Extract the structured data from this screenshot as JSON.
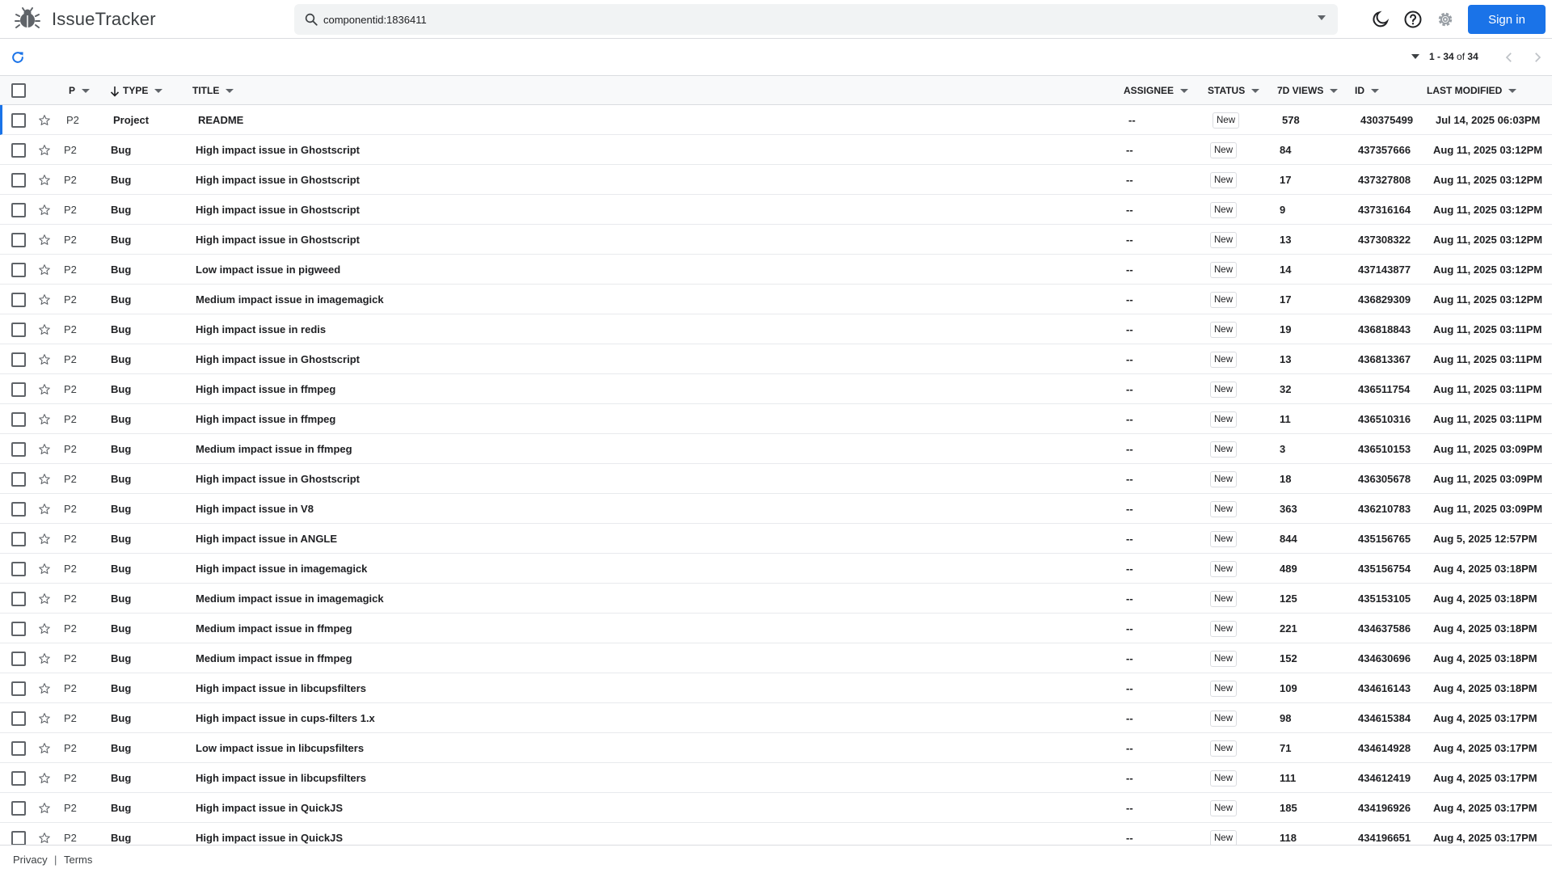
{
  "app": {
    "title": "IssueTracker"
  },
  "search": {
    "query": "componentid:1836411"
  },
  "header": {
    "sign_in_label": "Sign in"
  },
  "pagination": {
    "range": "1 - 34",
    "of_label": "of",
    "total": "34"
  },
  "columns": {
    "priority": "P",
    "type": "TYPE",
    "title": "TITLE",
    "assignee": "ASSIGNEE",
    "status": "STATUS",
    "views": "7D VIEWS",
    "id": "ID",
    "last_modified": "LAST MODIFIED"
  },
  "rows": [
    {
      "priority": "P2",
      "type": "Project",
      "title": "README",
      "assignee": "--",
      "status": "New",
      "views": "578",
      "id": "430375499",
      "last_modified": "Jul 14, 2025 06:03PM"
    },
    {
      "priority": "P2",
      "type": "Bug",
      "title": "High impact issue in Ghostscript",
      "assignee": "--",
      "status": "New",
      "views": "84",
      "id": "437357666",
      "last_modified": "Aug 11, 2025 03:12PM"
    },
    {
      "priority": "P2",
      "type": "Bug",
      "title": "High impact issue in Ghostscript",
      "assignee": "--",
      "status": "New",
      "views": "17",
      "id": "437327808",
      "last_modified": "Aug 11, 2025 03:12PM"
    },
    {
      "priority": "P2",
      "type": "Bug",
      "title": "High impact issue in Ghostscript",
      "assignee": "--",
      "status": "New",
      "views": "9",
      "id": "437316164",
      "last_modified": "Aug 11, 2025 03:12PM"
    },
    {
      "priority": "P2",
      "type": "Bug",
      "title": "High impact issue in Ghostscript",
      "assignee": "--",
      "status": "New",
      "views": "13",
      "id": "437308322",
      "last_modified": "Aug 11, 2025 03:12PM"
    },
    {
      "priority": "P2",
      "type": "Bug",
      "title": "Low impact issue in pigweed",
      "assignee": "--",
      "status": "New",
      "views": "14",
      "id": "437143877",
      "last_modified": "Aug 11, 2025 03:12PM"
    },
    {
      "priority": "P2",
      "type": "Bug",
      "title": "Medium impact issue in imagemagick",
      "assignee": "--",
      "status": "New",
      "views": "17",
      "id": "436829309",
      "last_modified": "Aug 11, 2025 03:12PM"
    },
    {
      "priority": "P2",
      "type": "Bug",
      "title": "High impact issue in redis",
      "assignee": "--",
      "status": "New",
      "views": "19",
      "id": "436818843",
      "last_modified": "Aug 11, 2025 03:11PM"
    },
    {
      "priority": "P2",
      "type": "Bug",
      "title": "High impact issue in Ghostscript",
      "assignee": "--",
      "status": "New",
      "views": "13",
      "id": "436813367",
      "last_modified": "Aug 11, 2025 03:11PM"
    },
    {
      "priority": "P2",
      "type": "Bug",
      "title": "High impact issue in ffmpeg",
      "assignee": "--",
      "status": "New",
      "views": "32",
      "id": "436511754",
      "last_modified": "Aug 11, 2025 03:11PM"
    },
    {
      "priority": "P2",
      "type": "Bug",
      "title": "High impact issue in ffmpeg",
      "assignee": "--",
      "status": "New",
      "views": "11",
      "id": "436510316",
      "last_modified": "Aug 11, 2025 03:11PM"
    },
    {
      "priority": "P2",
      "type": "Bug",
      "title": "Medium impact issue in ffmpeg",
      "assignee": "--",
      "status": "New",
      "views": "3",
      "id": "436510153",
      "last_modified": "Aug 11, 2025 03:09PM"
    },
    {
      "priority": "P2",
      "type": "Bug",
      "title": "High impact issue in Ghostscript",
      "assignee": "--",
      "status": "New",
      "views": "18",
      "id": "436305678",
      "last_modified": "Aug 11, 2025 03:09PM"
    },
    {
      "priority": "P2",
      "type": "Bug",
      "title": "High impact issue in V8",
      "assignee": "--",
      "status": "New",
      "views": "363",
      "id": "436210783",
      "last_modified": "Aug 11, 2025 03:09PM"
    },
    {
      "priority": "P2",
      "type": "Bug",
      "title": "High impact issue in ANGLE",
      "assignee": "--",
      "status": "New",
      "views": "844",
      "id": "435156765",
      "last_modified": "Aug 5, 2025 12:57PM"
    },
    {
      "priority": "P2",
      "type": "Bug",
      "title": "High impact issue in imagemagick",
      "assignee": "--",
      "status": "New",
      "views": "489",
      "id": "435156754",
      "last_modified": "Aug 4, 2025 03:18PM"
    },
    {
      "priority": "P2",
      "type": "Bug",
      "title": "Medium impact issue in imagemagick",
      "assignee": "--",
      "status": "New",
      "views": "125",
      "id": "435153105",
      "last_modified": "Aug 4, 2025 03:18PM"
    },
    {
      "priority": "P2",
      "type": "Bug",
      "title": "Medium impact issue in ffmpeg",
      "assignee": "--",
      "status": "New",
      "views": "221",
      "id": "434637586",
      "last_modified": "Aug 4, 2025 03:18PM"
    },
    {
      "priority": "P2",
      "type": "Bug",
      "title": "Medium impact issue in ffmpeg",
      "assignee": "--",
      "status": "New",
      "views": "152",
      "id": "434630696",
      "last_modified": "Aug 4, 2025 03:18PM"
    },
    {
      "priority": "P2",
      "type": "Bug",
      "title": "High impact issue in libcupsfilters",
      "assignee": "--",
      "status": "New",
      "views": "109",
      "id": "434616143",
      "last_modified": "Aug 4, 2025 03:18PM"
    },
    {
      "priority": "P2",
      "type": "Bug",
      "title": "High impact issue in cups-filters 1.x",
      "assignee": "--",
      "status": "New",
      "views": "98",
      "id": "434615384",
      "last_modified": "Aug 4, 2025 03:17PM"
    },
    {
      "priority": "P2",
      "type": "Bug",
      "title": "Low impact issue in libcupsfilters",
      "assignee": "--",
      "status": "New",
      "views": "71",
      "id": "434614928",
      "last_modified": "Aug 4, 2025 03:17PM"
    },
    {
      "priority": "P2",
      "type": "Bug",
      "title": "High impact issue in libcupsfilters",
      "assignee": "--",
      "status": "New",
      "views": "111",
      "id": "434612419",
      "last_modified": "Aug 4, 2025 03:17PM"
    },
    {
      "priority": "P2",
      "type": "Bug",
      "title": "High impact issue in QuickJS",
      "assignee": "--",
      "status": "New",
      "views": "185",
      "id": "434196926",
      "last_modified": "Aug 4, 2025 03:17PM"
    },
    {
      "priority": "P2",
      "type": "Bug",
      "title": "High impact issue in QuickJS",
      "assignee": "--",
      "status": "New",
      "views": "118",
      "id": "434196651",
      "last_modified": "Aug 4, 2025 03:17PM"
    }
  ],
  "footer": {
    "privacy": "Privacy",
    "separator": "|",
    "terms": "Terms"
  },
  "icons": {
    "logo": "bug-icon",
    "search": "search-icon",
    "theme": "dark-mode-icon",
    "help": "help-icon",
    "settings": "gear-icon",
    "refresh": "refresh-icon",
    "star": "star-outline-icon",
    "sort": "arrow-down-icon"
  },
  "colors": {
    "accent": "#1a73e8",
    "text": "#202124",
    "muted": "#5f6368",
    "border": "#dadce0"
  }
}
